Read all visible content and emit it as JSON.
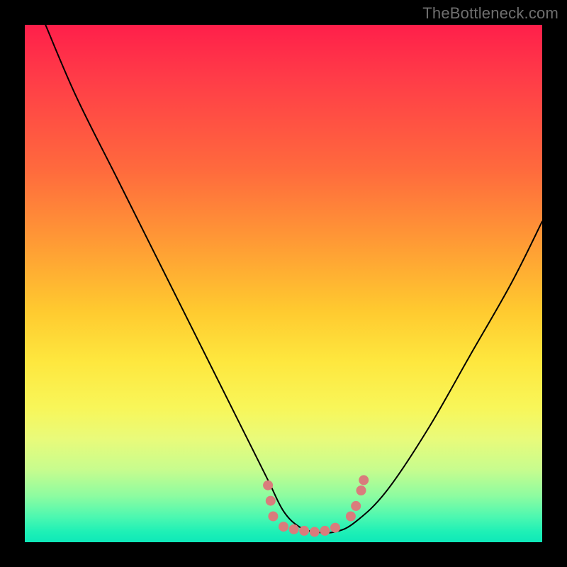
{
  "watermark": "TheBottleneck.com",
  "chart_data": {
    "type": "line",
    "title": "",
    "xlabel": "",
    "ylabel": "",
    "xlim": [
      0,
      100
    ],
    "ylim": [
      0,
      100
    ],
    "grid": false,
    "legend": false,
    "series": [
      {
        "name": "bottleneck-curve",
        "x": [
          4,
          10,
          18,
          26,
          34,
          42,
          47,
          50,
          53,
          56,
          60,
          64,
          70,
          78,
          86,
          94,
          100
        ],
        "y": [
          100,
          86,
          70,
          54,
          38,
          22,
          12,
          6,
          3,
          2,
          2,
          4,
          10,
          22,
          36,
          50,
          62
        ]
      }
    ],
    "markers": {
      "name": "highlight-dots",
      "color": "#d97c7c",
      "points": [
        {
          "x": 47,
          "y": 11
        },
        {
          "x": 47.5,
          "y": 8
        },
        {
          "x": 48,
          "y": 5
        },
        {
          "x": 50,
          "y": 3
        },
        {
          "x": 52,
          "y": 2.5
        },
        {
          "x": 54,
          "y": 2.2
        },
        {
          "x": 56,
          "y": 2
        },
        {
          "x": 58,
          "y": 2.2
        },
        {
          "x": 60,
          "y": 2.8
        },
        {
          "x": 63,
          "y": 5
        },
        {
          "x": 64,
          "y": 7
        },
        {
          "x": 65,
          "y": 10
        },
        {
          "x": 65.5,
          "y": 12
        }
      ]
    }
  }
}
